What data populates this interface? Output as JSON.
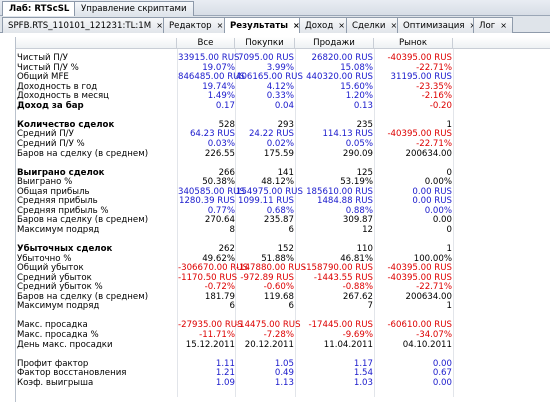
{
  "window_tabs": [
    {
      "label": "Лаб: RTScSL",
      "active": true
    },
    {
      "label": "Управление скриптами",
      "active": false
    }
  ],
  "sub_tabs": [
    {
      "label": "SPFB.RTS_110101_121231:TL:1M",
      "active": false
    },
    {
      "label": "Редактор",
      "active": false
    },
    {
      "label": "Результаты",
      "active": true
    },
    {
      "label": "Доход",
      "active": false
    },
    {
      "label": "Сделки",
      "active": false
    },
    {
      "label": "Оптимизация",
      "active": false
    },
    {
      "label": "Лог",
      "active": false
    }
  ],
  "close_glyph": "×",
  "columns": [
    "Все",
    "Покупки",
    "Продажи",
    "Рынок"
  ],
  "rows": [
    {
      "label": "Чистый П/У",
      "bold": false,
      "values": [
        "33915.00 RUS",
        "7095.00 RUS",
        "26820.00 RUS",
        "-40395.00 RUS"
      ],
      "colors": [
        "blue",
        "blue",
        "blue",
        "red"
      ]
    },
    {
      "label": "Чистый П/У %",
      "bold": false,
      "values": [
        "19.07%",
        "3.99%",
        "15.08%",
        "-22.71%"
      ],
      "colors": [
        "blue",
        "blue",
        "blue",
        "red"
      ]
    },
    {
      "label": "Общий MFE",
      "bold": false,
      "values": [
        "846485.00 RUS",
        "406165.00 RUS",
        "440320.00 RUS",
        "31195.00 RUS"
      ],
      "colors": [
        "blue",
        "blue",
        "blue",
        "blue"
      ]
    },
    {
      "label": "Доходность в год",
      "bold": false,
      "values": [
        "19.74%",
        "4.12%",
        "15.60%",
        "-23.35%"
      ],
      "colors": [
        "blue",
        "blue",
        "blue",
        "red"
      ]
    },
    {
      "label": "Доходность в месяц",
      "bold": false,
      "values": [
        "1.49%",
        "0.33%",
        "1.20%",
        "-2.16%"
      ],
      "colors": [
        "blue",
        "blue",
        "blue",
        "red"
      ]
    },
    {
      "label": "Доход за бар",
      "bold": true,
      "values": [
        "0.17",
        "0.04",
        "0.13",
        "-0.20"
      ],
      "colors": [
        "blue",
        "blue",
        "blue",
        "red"
      ]
    },
    {
      "label": "",
      "bold": false,
      "values": [
        "",
        "",
        "",
        ""
      ],
      "colors": [
        "black",
        "black",
        "black",
        "black"
      ]
    },
    {
      "label": "Количество сделок",
      "bold": true,
      "values": [
        "528",
        "293",
        "235",
        "1"
      ],
      "colors": [
        "black",
        "black",
        "black",
        "black"
      ]
    },
    {
      "label": "Средний П/У",
      "bold": false,
      "values": [
        "64.23 RUS",
        "24.22 RUS",
        "114.13 RUS",
        "-40395.00 RUS"
      ],
      "colors": [
        "blue",
        "blue",
        "blue",
        "red"
      ]
    },
    {
      "label": "Средний П/У %",
      "bold": false,
      "values": [
        "0.03%",
        "0.02%",
        "0.05%",
        "-22.71%"
      ],
      "colors": [
        "blue",
        "blue",
        "blue",
        "red"
      ]
    },
    {
      "label": "Баров на сделку (в среднем)",
      "bold": false,
      "values": [
        "226.55",
        "175.59",
        "290.09",
        "200634.00"
      ],
      "colors": [
        "black",
        "black",
        "black",
        "black"
      ]
    },
    {
      "label": "",
      "bold": false,
      "values": [
        "",
        "",
        "",
        ""
      ],
      "colors": [
        "black",
        "black",
        "black",
        "black"
      ]
    },
    {
      "label": "Выиграно сделок",
      "bold": true,
      "values": [
        "266",
        "141",
        "125",
        "0"
      ],
      "colors": [
        "black",
        "black",
        "black",
        "black"
      ]
    },
    {
      "label": "Выиграно %",
      "bold": false,
      "values": [
        "50.38%",
        "48.12%",
        "53.19%",
        "0.00%"
      ],
      "colors": [
        "black",
        "black",
        "black",
        "black"
      ]
    },
    {
      "label": "Общая прибыль",
      "bold": false,
      "values": [
        "340585.00 RUS",
        "154975.00 RUS",
        "185610.00 RUS",
        "0.00 RUS"
      ],
      "colors": [
        "blue",
        "blue",
        "blue",
        "blue"
      ]
    },
    {
      "label": "Средняя прибыль",
      "bold": false,
      "values": [
        "1280.39 RUS",
        "1099.11 RUS",
        "1484.88 RUS",
        "0.00 RUS"
      ],
      "colors": [
        "blue",
        "blue",
        "blue",
        "blue"
      ]
    },
    {
      "label": "Средняя прибыль %",
      "bold": false,
      "values": [
        "0.77%",
        "0.68%",
        "0.88%",
        "0.00%"
      ],
      "colors": [
        "blue",
        "blue",
        "blue",
        "blue"
      ]
    },
    {
      "label": "Баров на сделку (в среднем)",
      "bold": false,
      "values": [
        "270.64",
        "235.87",
        "309.87",
        "0.00"
      ],
      "colors": [
        "black",
        "black",
        "black",
        "black"
      ]
    },
    {
      "label": "Максимум подряд",
      "bold": false,
      "values": [
        "8",
        "6",
        "12",
        "0"
      ],
      "colors": [
        "black",
        "black",
        "black",
        "black"
      ]
    },
    {
      "label": "",
      "bold": false,
      "values": [
        "",
        "",
        "",
        ""
      ],
      "colors": [
        "black",
        "black",
        "black",
        "black"
      ]
    },
    {
      "label": "Убыточных сделок",
      "bold": true,
      "values": [
        "262",
        "152",
        "110",
        "1"
      ],
      "colors": [
        "black",
        "black",
        "black",
        "black"
      ]
    },
    {
      "label": "Убыточно %",
      "bold": false,
      "values": [
        "49.62%",
        "51.88%",
        "46.81%",
        "100.00%"
      ],
      "colors": [
        "black",
        "black",
        "black",
        "black"
      ]
    },
    {
      "label": "Общий убыток",
      "bold": false,
      "values": [
        "-306670.00 RUS",
        "-147880.00 RUS",
        "-158790.00 RUS",
        "-40395.00 RUS"
      ],
      "colors": [
        "red",
        "red",
        "red",
        "red"
      ]
    },
    {
      "label": "Средний убыток",
      "bold": false,
      "values": [
        "-1170.50 RUS",
        "-972.89 RUS",
        "-1443.55 RUS",
        "-40395.00 RUS"
      ],
      "colors": [
        "red",
        "red",
        "red",
        "red"
      ]
    },
    {
      "label": "Средний убыток %",
      "bold": false,
      "values": [
        "-0.72%",
        "-0.60%",
        "-0.88%",
        "-22.71%"
      ],
      "colors": [
        "red",
        "red",
        "red",
        "red"
      ]
    },
    {
      "label": "Баров на сделку (в среднем)",
      "bold": false,
      "values": [
        "181.79",
        "119.68",
        "267.62",
        "200634.00"
      ],
      "colors": [
        "black",
        "black",
        "black",
        "black"
      ]
    },
    {
      "label": "Максимум подряд",
      "bold": false,
      "values": [
        "6",
        "6",
        "7",
        "1"
      ],
      "colors": [
        "black",
        "black",
        "black",
        "black"
      ]
    },
    {
      "label": "",
      "bold": false,
      "values": [
        "",
        "",
        "",
        ""
      ],
      "colors": [
        "black",
        "black",
        "black",
        "black"
      ]
    },
    {
      "label": "Макс. просадка",
      "bold": false,
      "values": [
        "-27935.00 RUS",
        "-14475.00 RUS",
        "-17445.00 RUS",
        "-60610.00 RUS"
      ],
      "colors": [
        "red",
        "red",
        "red",
        "red"
      ]
    },
    {
      "label": "Макс. просадка %",
      "bold": false,
      "values": [
        "-11.71%",
        "-7.28%",
        "-9.69%",
        "-34.07%"
      ],
      "colors": [
        "red",
        "red",
        "red",
        "red"
      ]
    },
    {
      "label": "День макс. просадки",
      "bold": false,
      "values": [
        "15.12.2011",
        "20.12.2011",
        "11.04.2011",
        "04.10.2011"
      ],
      "colors": [
        "black",
        "black",
        "black",
        "black"
      ]
    },
    {
      "label": "",
      "bold": false,
      "values": [
        "",
        "",
        "",
        ""
      ],
      "colors": [
        "black",
        "black",
        "black",
        "black"
      ]
    },
    {
      "label": "Профит фактор",
      "bold": false,
      "values": [
        "1.11",
        "1.05",
        "1.17",
        "0.00"
      ],
      "colors": [
        "blue",
        "blue",
        "blue",
        "blue"
      ]
    },
    {
      "label": "Фактор восстановления",
      "bold": false,
      "values": [
        "1.21",
        "0.49",
        "1.54",
        "0.67"
      ],
      "colors": [
        "blue",
        "blue",
        "blue",
        "blue"
      ]
    },
    {
      "label": "Коэф. выигрыша",
      "bold": false,
      "values": [
        "1.09",
        "1.13",
        "1.03",
        "0.00"
      ],
      "colors": [
        "blue",
        "blue",
        "blue",
        "blue"
      ]
    }
  ]
}
